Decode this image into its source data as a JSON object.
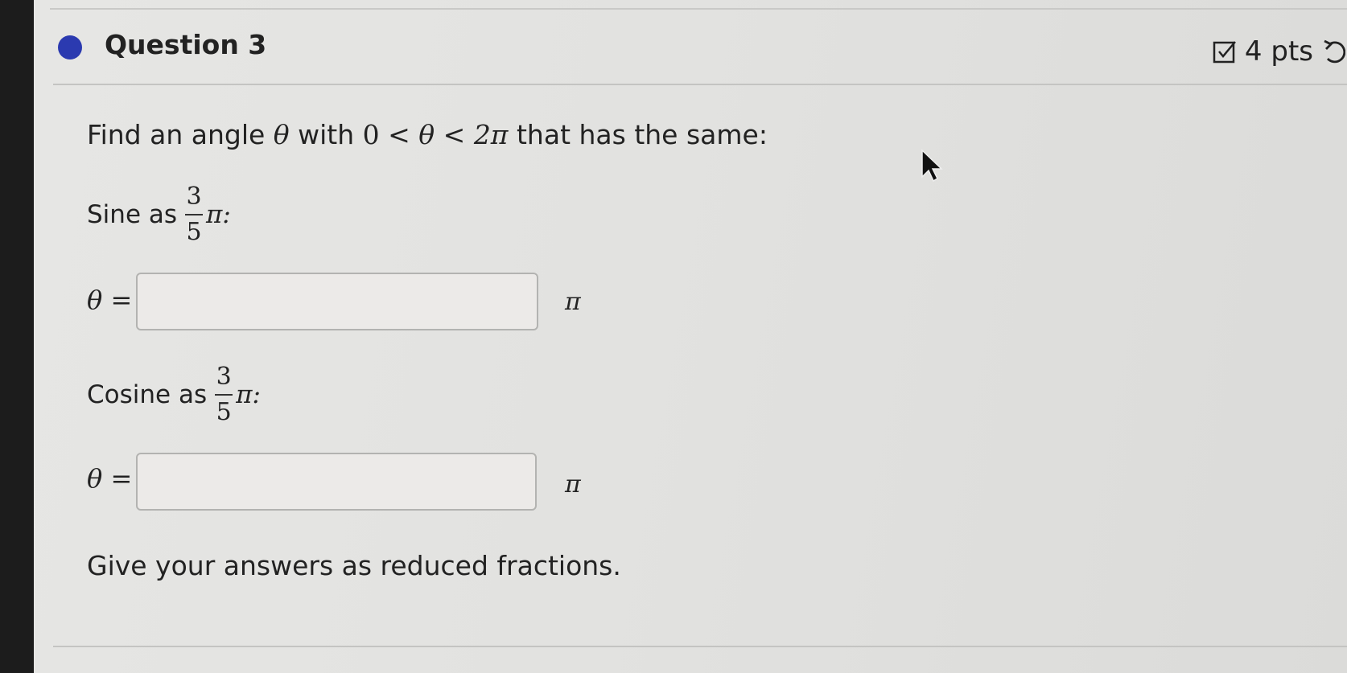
{
  "question": {
    "title": "Question 3",
    "points": "4 pts",
    "accent_color": "#2b3ab0"
  },
  "prompt": {
    "lead": "Find an angle ",
    "theta": "θ",
    "with": " with ",
    "zero": "0",
    "lt": " < ",
    "two_pi": "2π",
    "tail": " that has the same:"
  },
  "parts": [
    {
      "label": "Sine as",
      "numerator": "3",
      "denominator": "5",
      "suffix": "π:",
      "theta_label": "θ =",
      "answer_value": "",
      "unit": "π"
    },
    {
      "label": "Cosine as",
      "numerator": "3",
      "denominator": "5",
      "suffix": "π:",
      "theta_label": "θ =",
      "answer_value": "",
      "unit": "π"
    }
  ],
  "footer_note": "Give your answers as reduced fractions.",
  "icons": {
    "points_icon": "checkbox-check-icon",
    "refresh_icon": "undo-icon",
    "cursor": "mouse-pointer-icon"
  }
}
